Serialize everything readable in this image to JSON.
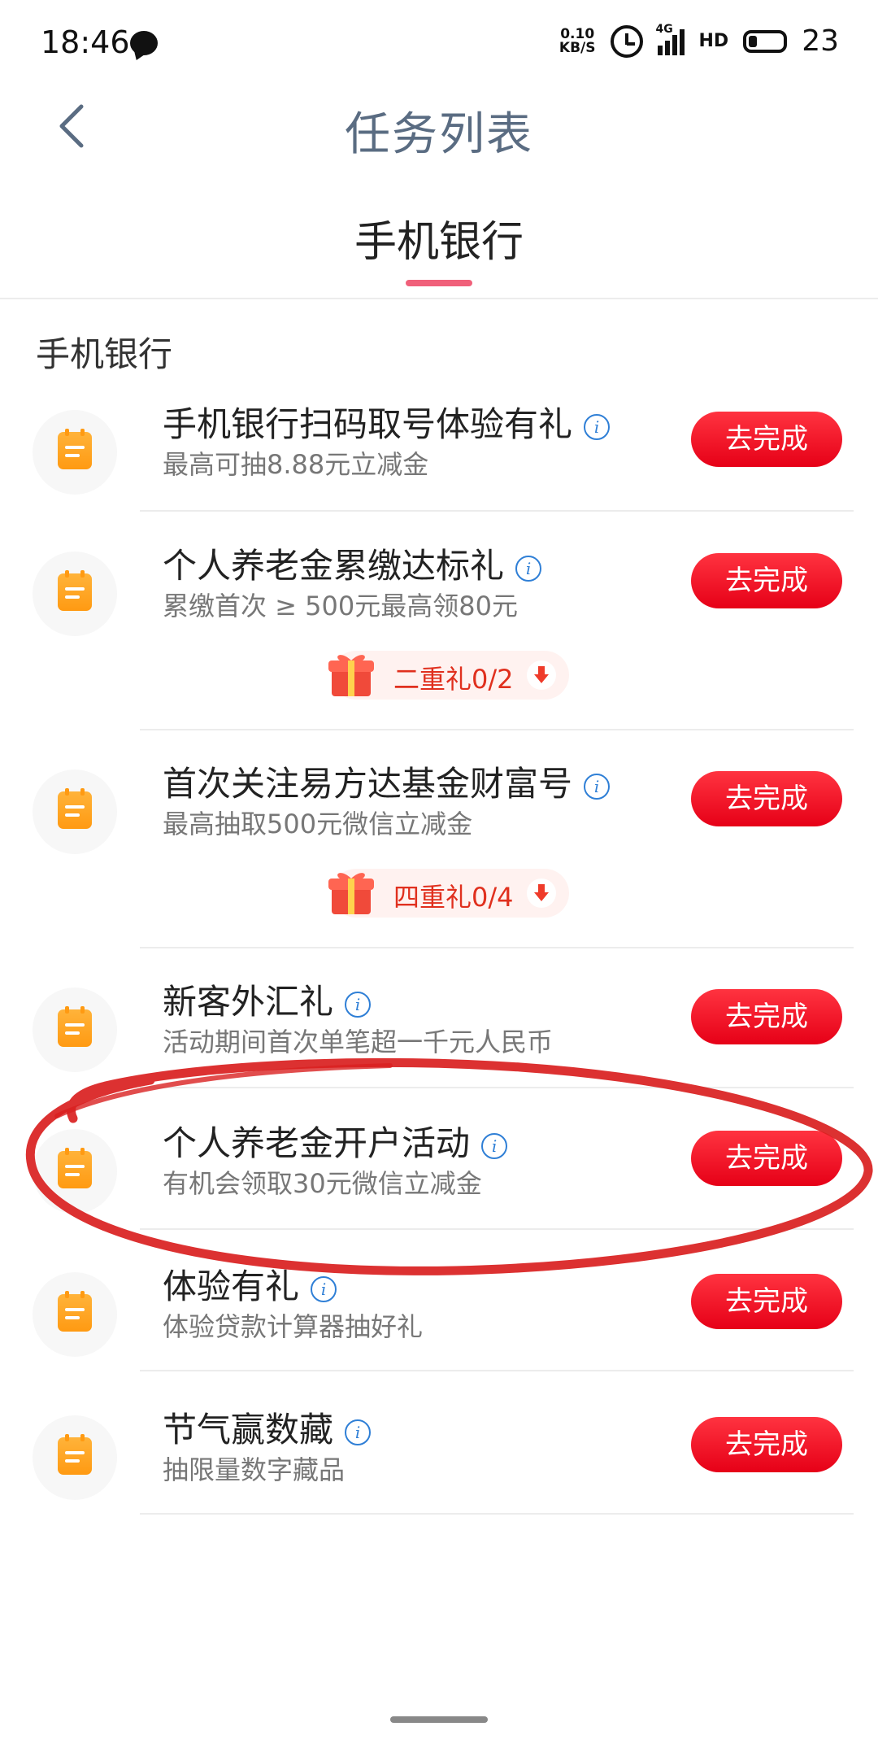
{
  "status_bar": {
    "time": "18:46",
    "net_speed_value": "0.10",
    "net_speed_unit": "KB/S",
    "network": "4G",
    "hd": "HD",
    "battery": "23"
  },
  "header": {
    "title": "任务列表",
    "back_icon": "chevron-left-icon"
  },
  "tabs": [
    {
      "label": "手机银行",
      "active": true
    }
  ],
  "colors": {
    "accent": "#f0607a",
    "button": "#ee1c25",
    "title": "#5a6c82",
    "icon": "#ff9a12",
    "info": "#2f7fd6",
    "annotation": "#d92020"
  },
  "section_title": "手机银行",
  "action_label": "去完成",
  "tasks": [
    {
      "title": "手机银行扫码取号体验有礼",
      "subtitle": "最高可抽8.88元立减金",
      "icon": "calendar-icon"
    },
    {
      "title": "个人养老金累缴达标礼",
      "subtitle": "累缴首次 ≥ 500元最高领80元",
      "icon": "calendar-icon",
      "gift": "二重礼0/2"
    },
    {
      "title": "首次关注易方达基金财富号",
      "subtitle": "最高抽取500元微信立减金",
      "icon": "calendar-icon",
      "gift": "四重礼0/4"
    },
    {
      "title": "新客外汇礼",
      "subtitle": "活动期间首次单笔超一千元人民币",
      "icon": "calendar-icon"
    },
    {
      "title": "个人养老金开户活动",
      "subtitle": "有机会领取30元微信立减金",
      "icon": "calendar-icon",
      "highlighted": true
    },
    {
      "title": "体验有礼",
      "subtitle": "体验贷款计算器抽好礼",
      "icon": "calendar-icon"
    },
    {
      "title": "节气赢数藏",
      "subtitle": "抽限量数字藏品",
      "icon": "calendar-icon"
    }
  ]
}
